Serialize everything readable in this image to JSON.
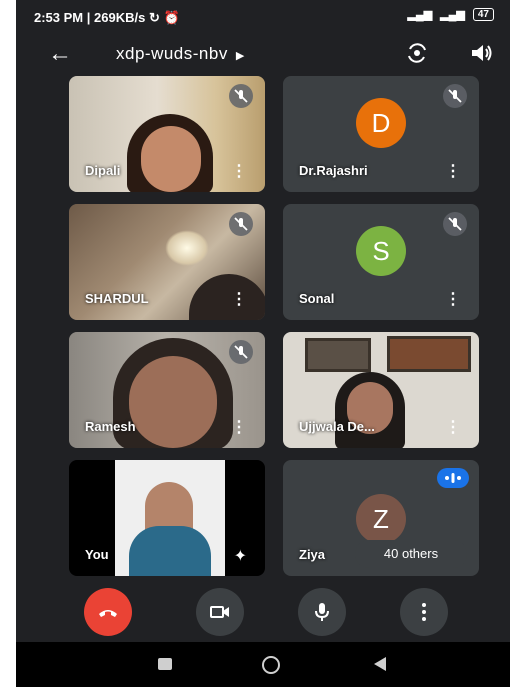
{
  "status_bar": {
    "time": "2:53 PM",
    "net_speed": "269KB/s",
    "battery": "47"
  },
  "header": {
    "meeting_code": "xdp-wuds-nbv"
  },
  "participants": [
    {
      "name": "Dipali",
      "muted": true,
      "has_video": true
    },
    {
      "name": "Dr.Rajashri",
      "muted": true,
      "has_video": false,
      "avatar_letter": "D",
      "avatar_color": "#e8710a"
    },
    {
      "name": "SHARDUL",
      "muted": true,
      "has_video": true
    },
    {
      "name": "Sonal",
      "muted": true,
      "has_video": false,
      "avatar_letter": "S",
      "avatar_color": "#7cb342"
    },
    {
      "name": "Ramesh",
      "muted": true,
      "has_video": true
    },
    {
      "name": "Ujjwala De...",
      "muted": false,
      "has_video": true
    },
    {
      "name": "You",
      "muted": false,
      "has_video": true
    },
    {
      "name": "Ziya",
      "muted": false,
      "has_video": false,
      "avatar_letter": "Z",
      "avatar_color": "#795548",
      "others_label": "40 others"
    }
  ],
  "colors": {
    "end_call": "#ea4335",
    "background": "#202124",
    "tile": "#3c4043",
    "speaking": "#1a73e8"
  }
}
